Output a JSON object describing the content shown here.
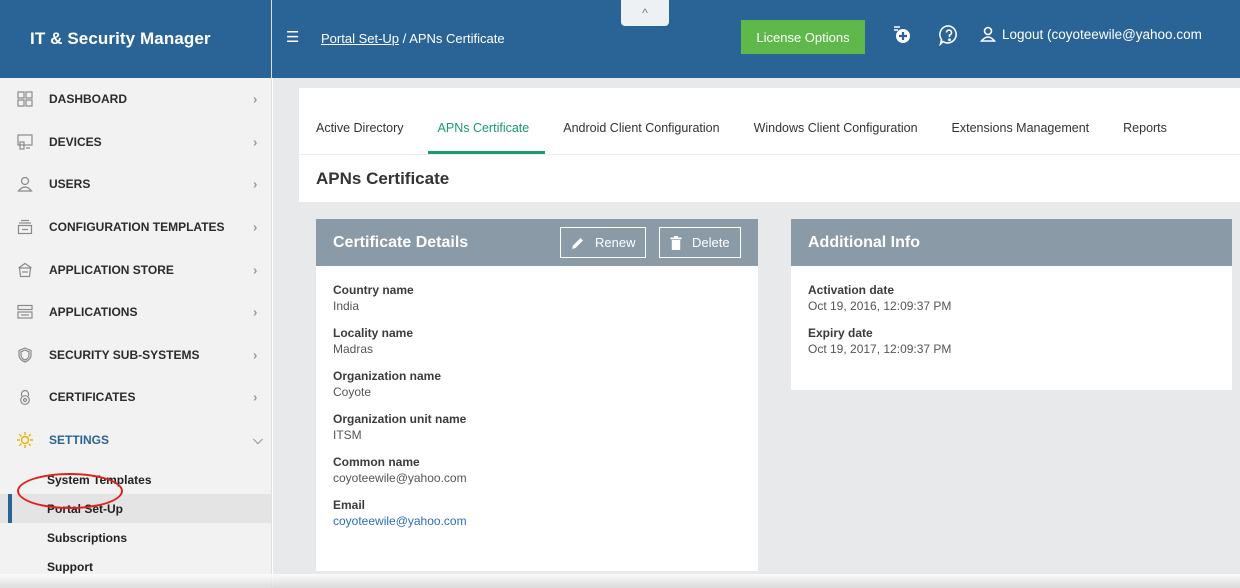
{
  "app": {
    "title": "IT & Security Manager"
  },
  "sidebar": {
    "items": [
      {
        "label": "DASHBOARD",
        "icon": "dashboard-icon"
      },
      {
        "label": "DEVICES",
        "icon": "devices-icon"
      },
      {
        "label": "USERS",
        "icon": "users-icon"
      },
      {
        "label": "CONFIGURATION TEMPLATES",
        "icon": "configuration-templates-icon"
      },
      {
        "label": "APPLICATION STORE",
        "icon": "application-store-icon"
      },
      {
        "label": "APPLICATIONS",
        "icon": "applications-icon"
      },
      {
        "label": "SECURITY SUB-SYSTEMS",
        "icon": "security-shield-icon"
      },
      {
        "label": "CERTIFICATES",
        "icon": "certificates-lock-icon"
      },
      {
        "label": "SETTINGS",
        "icon": "settings-gear-icon"
      }
    ],
    "submenu": [
      {
        "label": "System Templates"
      },
      {
        "label": "Portal Set-Up"
      },
      {
        "label": "Subscriptions"
      },
      {
        "label": "Support"
      }
    ],
    "highlight_color": "#e0201a"
  },
  "topbar": {
    "breadcrumb_link": "Portal Set-Up",
    "breadcrumb_sep": "/",
    "breadcrumb_current": "APNs Certificate",
    "license_button": "License Options",
    "logout_text": "Logout (coyoteewile@yahoo.com",
    "collapse_glyph": "^",
    "bg_color": "#2a6496",
    "license_color": "#5fb84a"
  },
  "tabs": [
    {
      "label": "Active Directory"
    },
    {
      "label": "APNs Certificate"
    },
    {
      "label": "Android Client Configuration"
    },
    {
      "label": "Windows Client Configuration"
    },
    {
      "label": "Extensions Management"
    },
    {
      "label": "Reports"
    }
  ],
  "page": {
    "title": "APNs Certificate"
  },
  "certificate": {
    "title": "Certificate Details",
    "renew_label": "Renew",
    "delete_label": "Delete",
    "fields": [
      {
        "label": "Country name",
        "value": "India"
      },
      {
        "label": "Locality name",
        "value": "Madras"
      },
      {
        "label": "Organization name",
        "value": "Coyote"
      },
      {
        "label": "Organization unit name",
        "value": "ITSM"
      },
      {
        "label": "Common name",
        "value": "coyoteewile@yahoo.com"
      },
      {
        "label": "Email",
        "value": "coyoteewile@yahoo.com"
      }
    ]
  },
  "additional": {
    "title": "Additional Info",
    "fields": [
      {
        "label": "Activation date",
        "value": "Oct 19, 2016, 12:09:37 PM"
      },
      {
        "label": "Expiry date",
        "value": "Oct 19, 2017, 12:09:37 PM"
      }
    ]
  }
}
